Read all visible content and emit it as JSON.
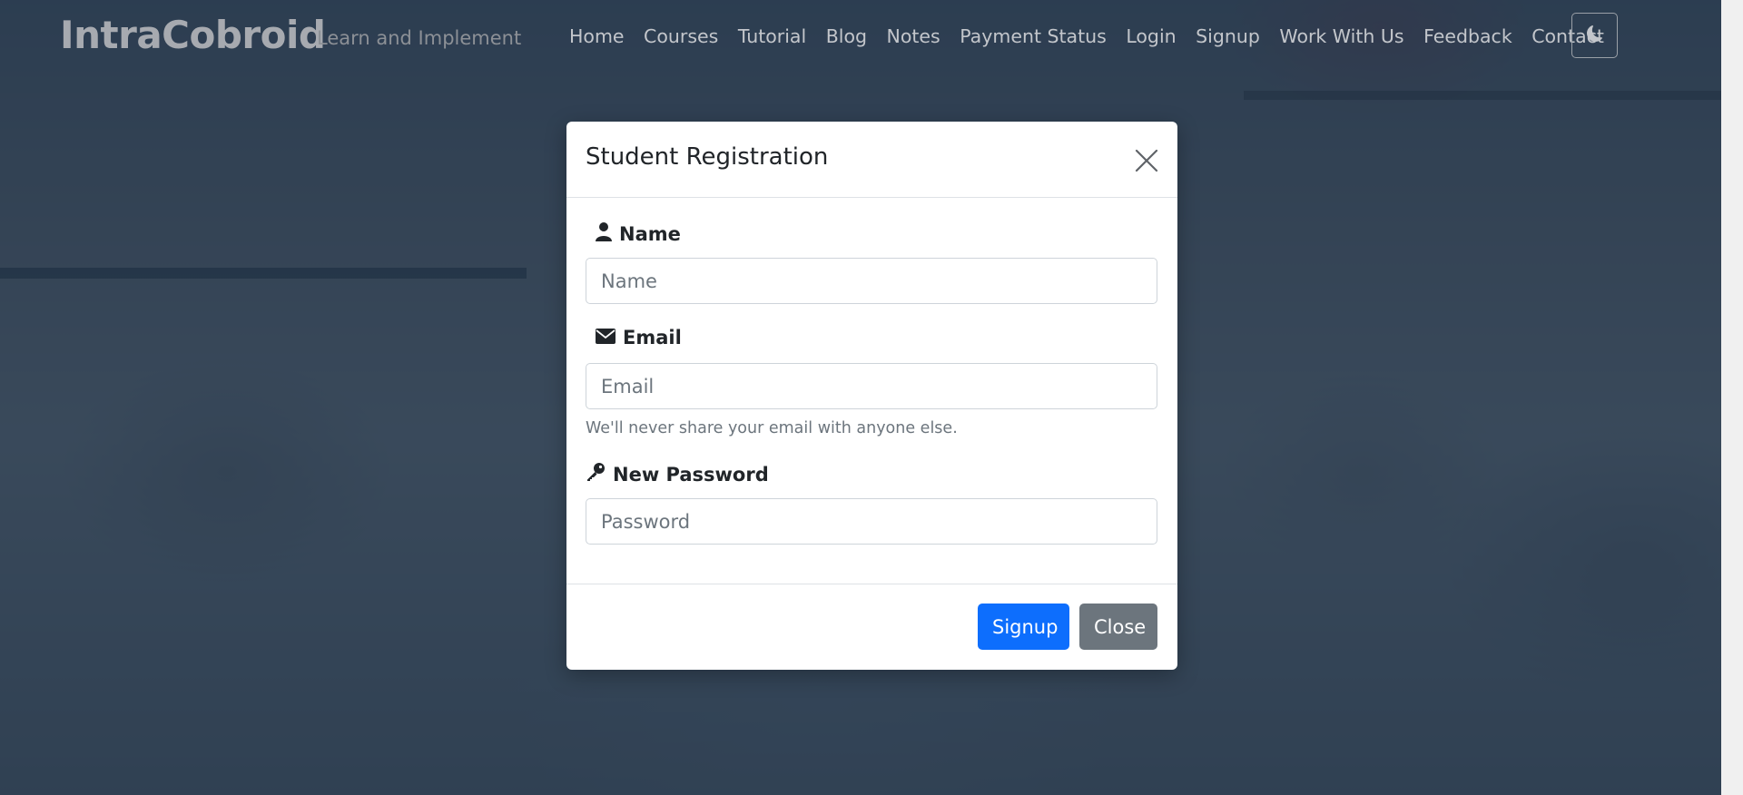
{
  "brand": {
    "name": "IntraCobroid",
    "tagline": "Learn and Implement"
  },
  "nav": {
    "items": [
      {
        "label": "Home"
      },
      {
        "label": "Courses"
      },
      {
        "label": "Tutorial"
      },
      {
        "label": "Blog"
      },
      {
        "label": "Notes"
      },
      {
        "label": "Payment Status"
      },
      {
        "label": "Login"
      },
      {
        "label": "Signup"
      },
      {
        "label": "Work With Us"
      },
      {
        "label": "Feedback"
      },
      {
        "label": "Contact"
      }
    ],
    "theme_toggle_icon": "moon-icon"
  },
  "modal": {
    "title": "Student Registration",
    "close_icon": "close-icon",
    "fields": {
      "name": {
        "label": "Name",
        "icon": "user-icon",
        "placeholder": "Name",
        "value": ""
      },
      "email": {
        "label": "Email",
        "icon": "envelope-icon",
        "placeholder": "Email",
        "value": "",
        "help": "We'll never share your email with anyone else."
      },
      "password": {
        "label": "New Password",
        "icon": "key-icon",
        "placeholder": "Password",
        "value": ""
      }
    },
    "buttons": {
      "submit": "Signup",
      "close": "Close"
    }
  },
  "colors": {
    "primary": "#0d6efd",
    "secondary": "#6c757d",
    "overlay": "#142d48"
  }
}
